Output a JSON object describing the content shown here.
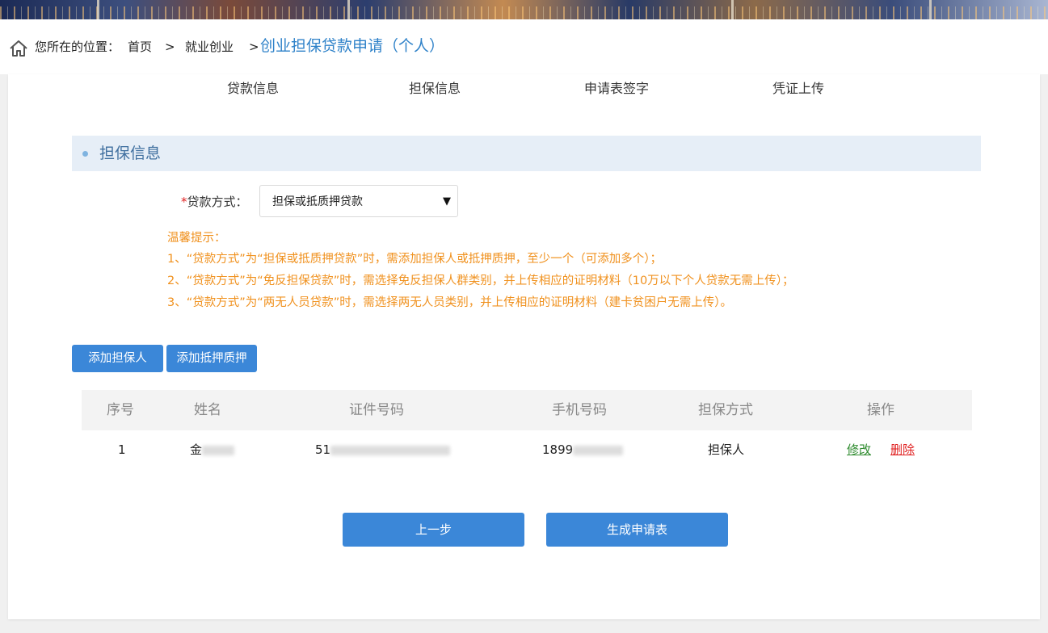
{
  "breadcrumb": {
    "prefix": "您所在的位置：",
    "home": "首页",
    "sep1": ">",
    "level2": "就业创业",
    "sep2": ">",
    "current": "创业担保贷款申请（个人）"
  },
  "steps": [
    "贷款信息",
    "担保信息",
    "申请表签字",
    "凭证上传"
  ],
  "section": {
    "title": "担保信息"
  },
  "form": {
    "loan_method_required": "*",
    "loan_method_label": "贷款方式：",
    "loan_method_value": "担保或抵质押贷款"
  },
  "tips": [
    "温馨提示：",
    "1、“贷款方式”为“担保或抵质押贷款”时，需添加担保人或抵押质押，至少一个（可添加多个）；",
    "2、“贷款方式”为“免反担保贷款”时，需选择免反担保人群类别，并上传相应的证明材料（10万以下个人贷款无需上传）；",
    "3、“贷款方式”为“两无人员贷款”时，需选择两无人员类别，并上传相应的证明材料（建卡贫困户无需上传）。"
  ],
  "buttons": {
    "add_guarantor": "添加担保人",
    "add_pledge": "添加抵押质押",
    "prev": "上一步",
    "generate": "生成申请表"
  },
  "table": {
    "headers": [
      "序号",
      "姓名",
      "证件号码",
      "手机号码",
      "担保方式",
      "操作"
    ],
    "rows": [
      {
        "index": "1",
        "name_visible": "金",
        "id_visible": "51",
        "phone_visible": "1899",
        "guarantee_type": "担保人",
        "edit": "修改",
        "delete": "删除"
      }
    ]
  },
  "colors": {
    "accent": "#3b87d8",
    "breadcrumb_current": "#2f82c9",
    "tip": "#f0911e",
    "required": "#e02020",
    "edit_link": "#2e8b2e",
    "delete_link": "#e02020",
    "section_bg": "#e6eef7"
  },
  "icons": {
    "home": "home-icon",
    "select_caret": "caret-down-icon",
    "section_bullet": "bullet-dot-icon"
  }
}
